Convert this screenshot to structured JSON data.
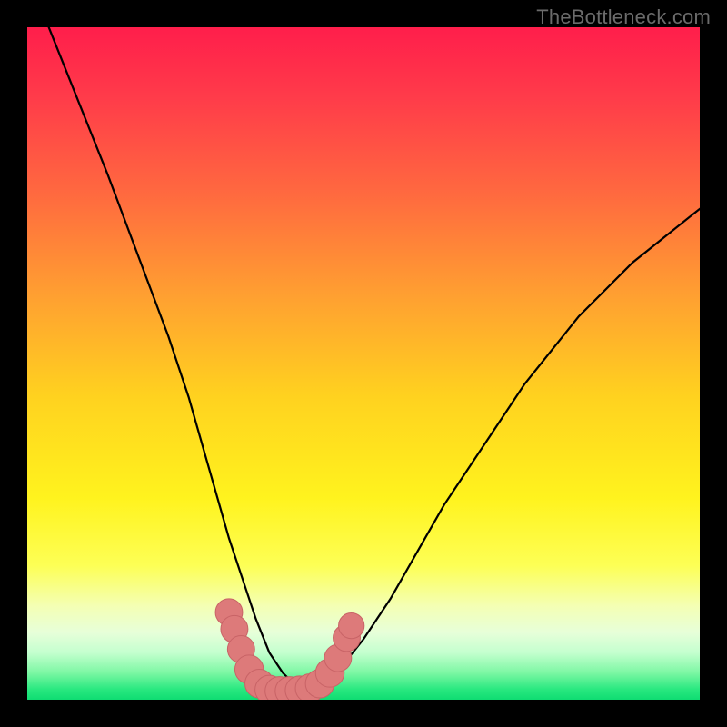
{
  "watermark": "TheBottleneck.com",
  "colors": {
    "frame": "#000000",
    "curve": "#000000",
    "marker_fill": "#dd7a7a",
    "marker_stroke": "#c86366",
    "gradient_stops": [
      {
        "offset": 0.0,
        "color": "#ff1e4b"
      },
      {
        "offset": 0.1,
        "color": "#ff3a4a"
      },
      {
        "offset": 0.25,
        "color": "#ff6a3f"
      },
      {
        "offset": 0.4,
        "color": "#ffa031"
      },
      {
        "offset": 0.55,
        "color": "#ffd21f"
      },
      {
        "offset": 0.7,
        "color": "#fff31e"
      },
      {
        "offset": 0.8,
        "color": "#fdff55"
      },
      {
        "offset": 0.86,
        "color": "#f4ffb3"
      },
      {
        "offset": 0.9,
        "color": "#e7ffd9"
      },
      {
        "offset": 0.93,
        "color": "#c4ffcf"
      },
      {
        "offset": 0.96,
        "color": "#7cf7a3"
      },
      {
        "offset": 0.985,
        "color": "#28e87f"
      },
      {
        "offset": 1.0,
        "color": "#0fdc72"
      }
    ]
  },
  "chart_data": {
    "type": "line",
    "title": "",
    "xlabel": "",
    "ylabel": "",
    "xlim": [
      0,
      100
    ],
    "ylim": [
      0,
      100
    ],
    "grid": false,
    "series": [
      {
        "name": "bottleneck-curve",
        "x": [
          0,
          4,
          8,
          12,
          15,
          18,
          21,
          24,
          26,
          28,
          30,
          32,
          34,
          36,
          38,
          40,
          43,
          46,
          50,
          54,
          58,
          62,
          66,
          70,
          74,
          78,
          82,
          86,
          90,
          95,
          100
        ],
        "values": [
          108,
          98,
          88,
          78,
          70,
          62,
          54,
          45,
          38,
          31,
          24,
          18,
          12,
          7,
          4,
          2,
          2,
          4,
          9,
          15,
          22,
          29,
          35,
          41,
          47,
          52,
          57,
          61,
          65,
          69,
          73
        ]
      }
    ],
    "markers": {
      "name": "highlight-band",
      "points": [
        {
          "x": 30.0,
          "y": 13.0,
          "r": 2.2
        },
        {
          "x": 30.8,
          "y": 10.5,
          "r": 2.2
        },
        {
          "x": 31.8,
          "y": 7.5,
          "r": 2.2
        },
        {
          "x": 33.0,
          "y": 4.5,
          "r": 2.4
        },
        {
          "x": 34.5,
          "y": 2.4,
          "r": 2.4
        },
        {
          "x": 36.0,
          "y": 1.5,
          "r": 2.4
        },
        {
          "x": 37.5,
          "y": 1.3,
          "r": 2.4
        },
        {
          "x": 39.0,
          "y": 1.3,
          "r": 2.4
        },
        {
          "x": 40.5,
          "y": 1.4,
          "r": 2.4
        },
        {
          "x": 42.0,
          "y": 1.7,
          "r": 2.4
        },
        {
          "x": 43.5,
          "y": 2.4,
          "r": 2.4
        },
        {
          "x": 45.0,
          "y": 4.0,
          "r": 2.4
        },
        {
          "x": 46.2,
          "y": 6.2,
          "r": 2.2
        },
        {
          "x": 47.5,
          "y": 9.2,
          "r": 2.2
        },
        {
          "x": 48.2,
          "y": 11.0,
          "r": 2.0
        }
      ]
    }
  }
}
